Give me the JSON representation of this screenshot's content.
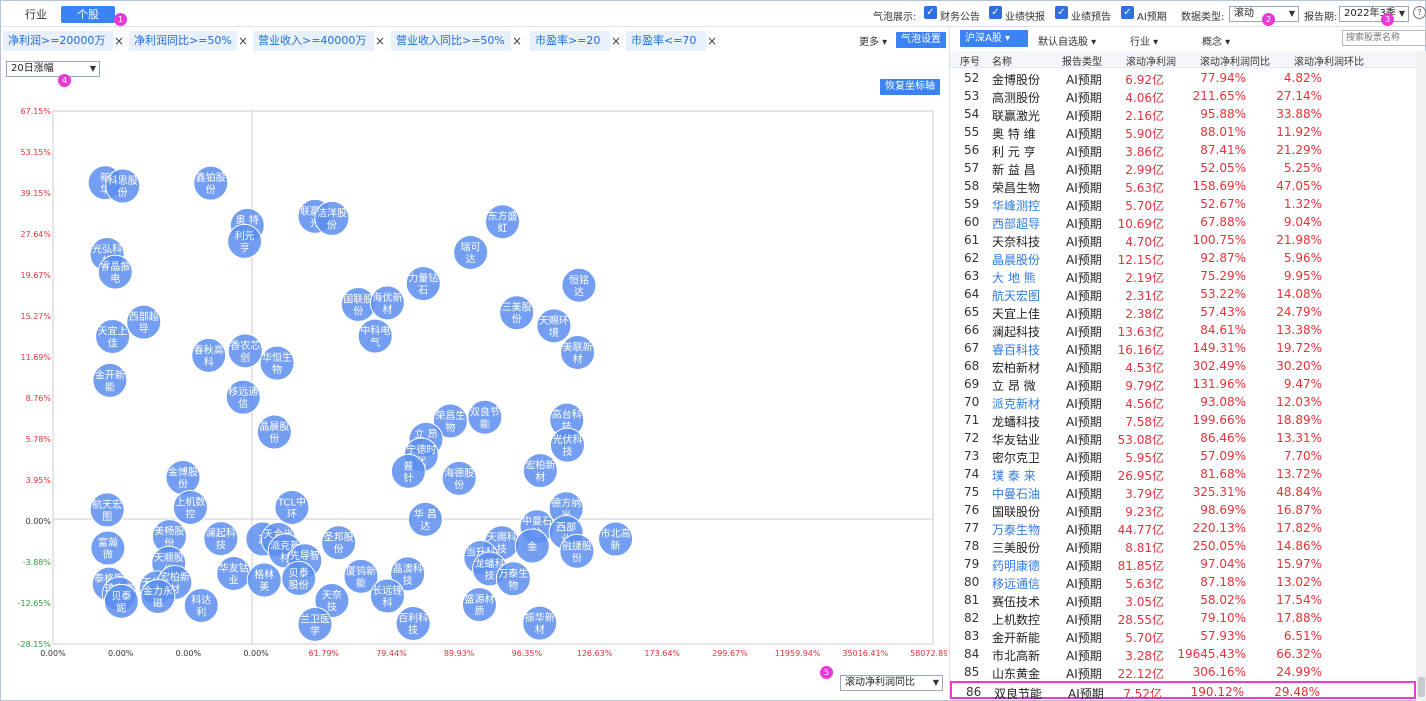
{
  "tabs": [
    {
      "label": "行业",
      "active": false
    },
    {
      "label": "个股",
      "active": true
    }
  ],
  "markers": [
    "1",
    "2",
    "3",
    "4",
    "5"
  ],
  "top_controls": {
    "bubble_label": "气泡展示:",
    "checks": [
      "财务公告",
      "业绩快报",
      "业绩预告",
      "AI预期"
    ],
    "data_type_label": "数据类型:",
    "data_type_value": "滚动",
    "report_label": "报告期:",
    "report_value": "2022年3季",
    "help_icon": "question-icon"
  },
  "filters": [
    "净利润>=20000万",
    "净利润同比>=50%",
    "营业收入>=40000万",
    "营业收入同比>=50%",
    "市盈率>=20",
    "市盈率<=70"
  ],
  "filter_close": "×",
  "more_label": "更多 ▾",
  "bubble_settings": "气泡设置",
  "left_dropdown": "20日涨幅",
  "reset_axis": "恢复坐标轴",
  "x_metric_dropdown": "滚动净利润同比",
  "right_toolbar": {
    "market": "沪深A股",
    "groups": [
      "默认自选股",
      "行业",
      "概念"
    ],
    "search_placeholder": "搜索股票名称"
  },
  "colors": {
    "accent": "#3b82f6",
    "bubble": "#5b8def",
    "positive": "#e8323a",
    "negative": "#2e9a3a",
    "highlight": "#e63bd6"
  },
  "chart_data": {
    "type": "scatter",
    "y_ticks": [
      "67.15%",
      "53.15%",
      "39.15%",
      "27.64%",
      "19.67%",
      "15.27%",
      "11.69%",
      "8.76%",
      "5.78%",
      "3.95%",
      "0.00%",
      "-3.88%",
      "-12.65%",
      "-28.15%"
    ],
    "x_ticks": [
      "0.00%",
      "0.00%",
      "0.00%",
      "0.00%",
      "61.79%",
      "79.44%",
      "89.93%",
      "96.35%",
      "126.63%",
      "173.64%",
      "299.67%",
      "11959.94%",
      "35016.41%",
      "58072.89%"
    ],
    "points": [
      {
        "label": "新\n华",
        "xi": 0.77,
        "yi": 1.75
      },
      {
        "label": "科思股\n份",
        "xi": 1.03,
        "yi": 1.83
      },
      {
        "label": "鑫铂股\n份",
        "xi": 2.33,
        "yi": 1.76
      },
      {
        "label": "奥 特\n维",
        "xi": 2.87,
        "yi": 2.79
      },
      {
        "label": "利元\n亨",
        "xi": 2.83,
        "yi": 3.18
      },
      {
        "label": "联赢激\n光",
        "xi": 3.87,
        "yi": 2.57
      },
      {
        "label": "洁洋股\n份",
        "xi": 4.12,
        "yi": 2.62
      },
      {
        "label": "东方盛\n虹",
        "xi": 6.64,
        "yi": 2.7
      },
      {
        "label": "瑞可\n达",
        "xi": 6.17,
        "yi": 3.45
      },
      {
        "label": "光弘科\n技",
        "xi": 0.8,
        "yi": 3.5
      },
      {
        "label": "睿晶振\n电",
        "xi": 0.92,
        "yi": 3.93
      },
      {
        "label": "力量钻\n石",
        "xi": 5.47,
        "yi": 4.21
      },
      {
        "label": "恒铭\n达",
        "xi": 7.77,
        "yi": 4.25
      },
      {
        "label": "国联股\n份",
        "xi": 4.51,
        "yi": 4.72
      },
      {
        "label": "海优新\n材",
        "xi": 4.94,
        "yi": 4.68
      },
      {
        "label": "三美股\n份",
        "xi": 6.85,
        "yi": 4.92
      },
      {
        "label": "西部超\n导",
        "xi": 1.34,
        "yi": 5.15
      },
      {
        "label": "天宜上\n佳",
        "xi": 0.88,
        "yi": 5.5
      },
      {
        "label": "中科电\n气",
        "xi": 4.76,
        "yi": 5.49
      },
      {
        "label": "天赐环\n境",
        "xi": 7.4,
        "yi": 5.24
      },
      {
        "label": "美联新\n材",
        "xi": 7.75,
        "yi": 5.89
      },
      {
        "label": "春秋高\n科",
        "xi": 2.3,
        "yi": 5.96
      },
      {
        "label": "香农芯\n创",
        "xi": 2.84,
        "yi": 5.85
      },
      {
        "label": "华恒生\n物",
        "xi": 3.31,
        "yi": 6.15
      },
      {
        "label": "金开新\n能",
        "xi": 0.84,
        "yi": 6.57
      },
      {
        "label": "移远通\n信",
        "xi": 2.81,
        "yi": 6.98
      },
      {
        "label": "荣昌生\n物",
        "xi": 5.87,
        "yi": 7.56
      },
      {
        "label": "双良节\n能",
        "xi": 6.38,
        "yi": 7.47
      },
      {
        "label": "晶晨股\n份",
        "xi": 3.27,
        "yi": 7.83
      },
      {
        "label": "高台科\n技",
        "xi": 7.59,
        "yi": 7.54
      },
      {
        "label": "立 昂\n微",
        "xi": 5.51,
        "yi": 8.01
      },
      {
        "label": "宁德时\n代",
        "xi": 5.44,
        "yi": 8.39
      },
      {
        "label": "普\n针",
        "xi": 5.25,
        "yi": 8.79
      },
      {
        "label": "光伏科\n技",
        "xi": 7.6,
        "yi": 8.15
      },
      {
        "label": "宏柏新\n材",
        "xi": 7.2,
        "yi": 8.77
      },
      {
        "label": "海德股\n份",
        "xi": 6.0,
        "yi": 8.96
      },
      {
        "label": "金博股\n份",
        "xi": 1.92,
        "yi": 8.94
      },
      {
        "label": "航天宏\n图",
        "xi": 0.8,
        "yi": 9.73
      },
      {
        "label": "上机数\n控",
        "xi": 2.03,
        "yi": 9.67
      },
      {
        "label": "TCL中\n环",
        "xi": 3.53,
        "yi": 9.67
      },
      {
        "label": "华 昌\n达",
        "xi": 5.5,
        "yi": 9.96
      },
      {
        "label": "德方纳\n米",
        "xi": 7.58,
        "yi": 9.7
      },
      {
        "label": "中曼石\n油",
        "xi": 7.15,
        "yi": 10.14
      },
      {
        "label": "西部\n业",
        "xi": 7.58,
        "yi": 10.28
      },
      {
        "label": "市北高\n新",
        "xi": 8.31,
        "yi": 10.44
      },
      {
        "label": "富瀚\n微",
        "xi": 0.81,
        "yi": 10.66
      },
      {
        "label": "美畅股\n份",
        "xi": 1.72,
        "yi": 10.38
      },
      {
        "label": "澜起科\n技",
        "xi": 2.48,
        "yi": 10.43
      },
      {
        "label": "正",
        "xi": 3.1,
        "yi": 10.44
      },
      {
        "label": "天合光\n能",
        "xi": 3.33,
        "yi": 10.45
      },
      {
        "label": "派克新\n材",
        "xi": 3.43,
        "yi": 10.73
      },
      {
        "label": "圣邦股\n份",
        "xi": 4.22,
        "yi": 10.53
      },
      {
        "label": "天赐科\n技",
        "xi": 6.63,
        "yi": 10.53
      },
      {
        "label": "金",
        "xi": 7.08,
        "yi": 10.61
      },
      {
        "label": "融捷股\n份",
        "xi": 7.74,
        "yi": 10.74
      },
      {
        "label": "当升科\n技",
        "xi": 6.32,
        "yi": 10.89
      },
      {
        "label": "先导智\n能",
        "xi": 3.72,
        "yi": 10.97
      },
      {
        "label": "天顺股\n份",
        "xi": 1.71,
        "yi": 11.03
      },
      {
        "label": "华友钴\n业",
        "xi": 2.67,
        "yi": 11.28
      },
      {
        "label": "格林\n美",
        "xi": 3.12,
        "yi": 11.44
      },
      {
        "label": "贝泰\n股份",
        "xi": 3.63,
        "yi": 11.4
      },
      {
        "label": "厦钨新\n能",
        "xi": 4.55,
        "yi": 11.35
      },
      {
        "label": "晶澳科\n技",
        "xi": 5.24,
        "yi": 11.29
      },
      {
        "label": "龙蟠科\n技",
        "xi": 6.45,
        "yi": 11.17
      },
      {
        "label": "万泰生\n物",
        "xi": 6.8,
        "yi": 11.41
      },
      {
        "label": "泰格医\n药",
        "xi": 0.83,
        "yi": 11.54
      },
      {
        "label": "璞泰来\n天",
        "xi": 0.98,
        "yi": 11.78
      },
      {
        "label": "天华超\n净",
        "xi": 1.53,
        "yi": 11.63
      },
      {
        "label": "宏柏新\n材",
        "xi": 1.8,
        "yi": 11.5
      },
      {
        "label": "贝泰\n妮",
        "xi": 1.01,
        "yi": 11.96
      },
      {
        "label": "金力永\n磁",
        "xi": 1.55,
        "yi": 11.84
      },
      {
        "label": "科达\n利",
        "xi": 2.19,
        "yi": 12.06
      },
      {
        "label": "天奈\n技",
        "xi": 4.12,
        "yi": 11.94
      },
      {
        "label": "长远锂\n科",
        "xi": 4.94,
        "yi": 11.83
      },
      {
        "label": "盛源材\n质",
        "xi": 6.3,
        "yi": 12.04
      },
      {
        "label": "兰卫医\n学",
        "xi": 3.87,
        "yi": 12.52
      },
      {
        "label": "百利科\n技",
        "xi": 5.32,
        "yi": 12.5
      },
      {
        "label": "振华新\n材",
        "xi": 7.19,
        "yi": 12.49
      }
    ]
  },
  "table": {
    "headers": [
      "序号",
      "名称",
      "报告类型",
      "滚动净利润",
      "滚动净利润同比",
      "滚动净利润环比"
    ],
    "rows": [
      {
        "seq": "52",
        "name": "金博股份",
        "type": "AI预期",
        "v1": "6.92亿",
        "v2": "77.94%",
        "v3": "4.82%",
        "link": false
      },
      {
        "seq": "53",
        "name": "高测股份",
        "type": "AI预期",
        "v1": "4.06亿",
        "v2": "211.65%",
        "v3": "27.14%",
        "link": false
      },
      {
        "seq": "54",
        "name": "联赢激光",
        "type": "AI预期",
        "v1": "2.16亿",
        "v2": "95.88%",
        "v3": "33.88%",
        "link": false
      },
      {
        "seq": "55",
        "name": "奥 特 维",
        "type": "AI预期",
        "v1": "5.90亿",
        "v2": "88.01%",
        "v3": "11.92%",
        "link": false
      },
      {
        "seq": "56",
        "name": "利 元 亨",
        "type": "AI预期",
        "v1": "3.86亿",
        "v2": "87.41%",
        "v3": "21.29%",
        "link": false
      },
      {
        "seq": "57",
        "name": "新 益 昌",
        "type": "AI预期",
        "v1": "2.99亿",
        "v2": "52.05%",
        "v3": "5.25%",
        "link": false
      },
      {
        "seq": "58",
        "name": "荣昌生物",
        "type": "AI预期",
        "v1": "5.63亿",
        "v2": "158.69%",
        "v3": "47.05%",
        "link": false
      },
      {
        "seq": "59",
        "name": "华峰测控",
        "type": "AI预期",
        "v1": "5.70亿",
        "v2": "52.67%",
        "v3": "1.32%",
        "link": true
      },
      {
        "seq": "60",
        "name": "西部超导",
        "type": "AI预期",
        "v1": "10.69亿",
        "v2": "67.88%",
        "v3": "9.04%",
        "link": true
      },
      {
        "seq": "61",
        "name": "天奈科技",
        "type": "AI预期",
        "v1": "4.70亿",
        "v2": "100.75%",
        "v3": "21.98%",
        "link": false
      },
      {
        "seq": "62",
        "name": "晶晨股份",
        "type": "AI预期",
        "v1": "12.15亿",
        "v2": "92.87%",
        "v3": "5.96%",
        "link": true
      },
      {
        "seq": "63",
        "name": "大 地 熊",
        "type": "AI预期",
        "v1": "2.19亿",
        "v2": "75.29%",
        "v3": "9.95%",
        "link": true
      },
      {
        "seq": "64",
        "name": "航天宏图",
        "type": "AI预期",
        "v1": "2.31亿",
        "v2": "53.22%",
        "v3": "14.08%",
        "link": true
      },
      {
        "seq": "65",
        "name": "天宜上佳",
        "type": "AI预期",
        "v1": "2.38亿",
        "v2": "57.43%",
        "v3": "24.79%",
        "link": false
      },
      {
        "seq": "66",
        "name": "澜起科技",
        "type": "AI预期",
        "v1": "13.63亿",
        "v2": "84.61%",
        "v3": "13.38%",
        "link": false
      },
      {
        "seq": "67",
        "name": "睿百科技",
        "type": "AI预期",
        "v1": "16.16亿",
        "v2": "149.31%",
        "v3": "19.72%",
        "link": true
      },
      {
        "seq": "68",
        "name": "宏柏新材",
        "type": "AI预期",
        "v1": "4.53亿",
        "v2": "302.49%",
        "v3": "30.20%",
        "link": false
      },
      {
        "seq": "69",
        "name": "立 昂 微",
        "type": "AI预期",
        "v1": "9.79亿",
        "v2": "131.96%",
        "v3": "9.47%",
        "link": false
      },
      {
        "seq": "70",
        "name": "派克新材",
        "type": "AI预期",
        "v1": "4.56亿",
        "v2": "93.08%",
        "v3": "12.03%",
        "link": true
      },
      {
        "seq": "71",
        "name": "龙蟠科技",
        "type": "AI预期",
        "v1": "7.58亿",
        "v2": "199.66%",
        "v3": "18.89%",
        "link": false
      },
      {
        "seq": "72",
        "name": "华友钴业",
        "type": "AI预期",
        "v1": "53.08亿",
        "v2": "86.46%",
        "v3": "13.31%",
        "link": false
      },
      {
        "seq": "73",
        "name": "密尔克卫",
        "type": "AI预期",
        "v1": "5.95亿",
        "v2": "57.09%",
        "v3": "7.70%",
        "link": false
      },
      {
        "seq": "74",
        "name": "璞 泰 来",
        "type": "AI预期",
        "v1": "26.95亿",
        "v2": "81.68%",
        "v3": "13.72%",
        "link": true
      },
      {
        "seq": "75",
        "name": "中曼石油",
        "type": "AI预期",
        "v1": "3.79亿",
        "v2": "325.31%",
        "v3": "48.84%",
        "link": true
      },
      {
        "seq": "76",
        "name": "国联股份",
        "type": "AI预期",
        "v1": "9.23亿",
        "v2": "98.69%",
        "v3": "16.87%",
        "link": false
      },
      {
        "seq": "77",
        "name": "万泰生物",
        "type": "AI预期",
        "v1": "44.77亿",
        "v2": "220.13%",
        "v3": "17.82%",
        "link": true
      },
      {
        "seq": "78",
        "name": "三美股份",
        "type": "AI预期",
        "v1": "8.81亿",
        "v2": "250.05%",
        "v3": "14.86%",
        "link": false
      },
      {
        "seq": "79",
        "name": "药明康德",
        "type": "AI预期",
        "v1": "81.85亿",
        "v2": "97.04%",
        "v3": "15.97%",
        "link": true
      },
      {
        "seq": "80",
        "name": "移远通信",
        "type": "AI预期",
        "v1": "5.63亿",
        "v2": "87.18%",
        "v3": "13.02%",
        "link": true
      },
      {
        "seq": "81",
        "name": "赛伍技术",
        "type": "AI预期",
        "v1": "3.05亿",
        "v2": "58.02%",
        "v3": "17.54%",
        "link": false
      },
      {
        "seq": "82",
        "name": "上机数控",
        "type": "AI预期",
        "v1": "28.55亿",
        "v2": "79.10%",
        "v3": "17.88%",
        "link": false
      },
      {
        "seq": "83",
        "name": "金开新能",
        "type": "AI预期",
        "v1": "5.70亿",
        "v2": "57.93%",
        "v3": "6.51%",
        "link": false
      },
      {
        "seq": "84",
        "name": "市北高新",
        "type": "AI预期",
        "v1": "3.28亿",
        "v2": "19645.43%",
        "v3": "66.32%",
        "link": false
      },
      {
        "seq": "85",
        "name": "山东黄金",
        "type": "AI预期",
        "v1": "22.12亿",
        "v2": "306.16%",
        "v3": "24.99%",
        "link": false
      },
      {
        "seq": "86",
        "name": "双良节能",
        "type": "AI预期",
        "v1": "7.52亿",
        "v2": "190.12%",
        "v3": "29.48%",
        "link": false,
        "selected": true
      }
    ]
  }
}
